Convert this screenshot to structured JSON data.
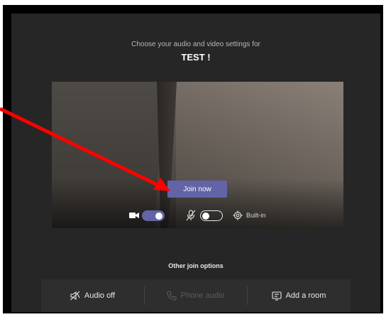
{
  "header": {
    "subtitle": "Choose your audio and video settings for",
    "meeting_title": "TEST !"
  },
  "preview": {
    "join_button_label": "Join now"
  },
  "controls": {
    "camera_toggle_state": "on",
    "camera_icon": "video-camera-icon",
    "mic_icon": "microphone-muted-icon",
    "mic_toggle_state": "off",
    "device_icon": "gear-icon",
    "device_label": "Built-in"
  },
  "other_options": {
    "label": "Other join options",
    "items": [
      {
        "label": "Audio off",
        "icon": "speaker-off-icon",
        "enabled": true
      },
      {
        "label": "Phone audio",
        "icon": "phone-icon",
        "enabled": false
      },
      {
        "label": "Add a room",
        "icon": "cast-icon",
        "enabled": true
      }
    ]
  },
  "colors": {
    "accent": "#6264a7",
    "background": "#262626",
    "annotation_arrow": "#ff0000"
  }
}
